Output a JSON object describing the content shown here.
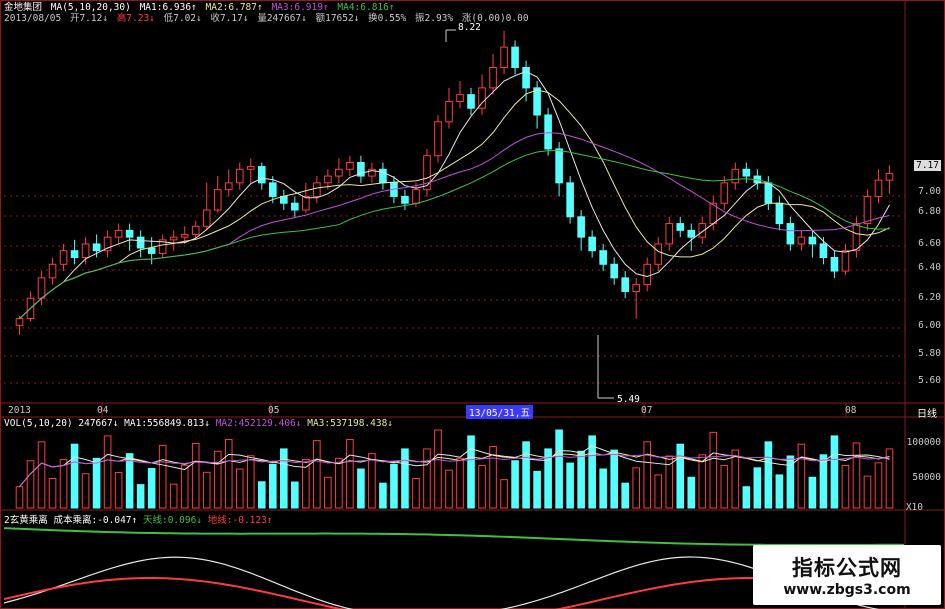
{
  "header": {
    "stock_name": "金地集团",
    "ma_label": "MA(5,10,20,30)",
    "ma1": "MA1:6.936↑",
    "ma2": "MA2:6.787↑",
    "ma3": "MA3:6.919↑",
    "ma4": "MA4:6.816↑",
    "date": "2013/08/05",
    "open": "开7.12↓",
    "high": "高7.23↓",
    "low": "低7.02↓",
    "close": "收7.17↓",
    "volume": "量247667↓",
    "amount": "额17652↓",
    "turnover": "换0.55%",
    "amplitude": "振2.93%",
    "change": "涨(0.00)0.00"
  },
  "price_axis": {
    "ticks": [
      "7.00",
      "6.80",
      "6.60",
      "6.40",
      "6.20",
      "6.00",
      "5.80",
      "5.60"
    ],
    "current_price": "7.17"
  },
  "annotations": {
    "high_mark": "8.22",
    "low_mark": "5.49"
  },
  "time_axis": {
    "labels": [
      "2013",
      "04",
      "05",
      "07",
      "08"
    ],
    "cursor_date": "13/05/31,五",
    "period": "日线"
  },
  "volume_panel": {
    "title": "VOL(5,10,20)",
    "value": "247667↓",
    "ma1": "MA1:556849.813↓",
    "ma2": "MA2:452129.406↓",
    "ma3": "MA3:537198.438↓",
    "ticks": [
      "100000",
      "50000"
    ],
    "unit": "X10"
  },
  "indicator_panel": {
    "title": "2玄黄乘离",
    "cost": "成本乘离:-0.047↑",
    "sky": "天线:0.096↓",
    "ground": "地线:-0.123↑"
  },
  "watermark": {
    "line1": "指标公式网",
    "line2": "www.zbgs3.com"
  },
  "colors": {
    "up": "#ff3c3c",
    "down": "#54ffff",
    "ma_white": "#e6e6e6",
    "ma_yellow": "#e8e89a",
    "ma_purple": "#c050e0",
    "ma_green": "#40c040",
    "grid": "#8b1a1a"
  },
  "chart_data": {
    "type": "candlestick",
    "price_ylim": [
      5.5,
      7.3
    ],
    "candles": [
      [
        6.05,
        6.1,
        5.98,
        6.12
      ],
      [
        6.1,
        6.25,
        6.08,
        6.3
      ],
      [
        6.25,
        6.4,
        6.2,
        6.45
      ],
      [
        6.4,
        6.5,
        6.35,
        6.55
      ],
      [
        6.5,
        6.6,
        6.45,
        6.65
      ],
      [
        6.6,
        6.55,
        6.5,
        6.68
      ],
      [
        6.55,
        6.65,
        6.5,
        6.7
      ],
      [
        6.65,
        6.6,
        6.55,
        6.72
      ],
      [
        6.6,
        6.7,
        6.55,
        6.75
      ],
      [
        6.7,
        6.75,
        6.65,
        6.8
      ],
      [
        6.75,
        6.7,
        6.6,
        6.8
      ],
      [
        6.7,
        6.62,
        6.55,
        6.75
      ],
      [
        6.62,
        6.58,
        6.5,
        6.7
      ],
      [
        6.58,
        6.68,
        6.55,
        6.72
      ],
      [
        6.68,
        6.7,
        6.6,
        6.75
      ],
      [
        6.7,
        6.72,
        6.65,
        6.78
      ],
      [
        6.72,
        6.78,
        6.68,
        6.82
      ],
      [
        6.78,
        6.9,
        6.75,
        7.1
      ],
      [
        6.9,
        7.05,
        6.88,
        7.15
      ],
      [
        7.05,
        7.1,
        7.0,
        7.2
      ],
      [
        7.1,
        7.2,
        7.05,
        7.25
      ],
      [
        7.2,
        7.22,
        7.1,
        7.28
      ],
      [
        7.22,
        7.1,
        7.05,
        7.25
      ],
      [
        7.1,
        7.0,
        6.95,
        7.15
      ],
      [
        7.0,
        6.95,
        6.9,
        7.05
      ],
      [
        6.95,
        6.9,
        6.85,
        7.0
      ],
      [
        6.9,
        7.0,
        6.88,
        7.1
      ],
      [
        7.0,
        7.1,
        6.95,
        7.15
      ],
      [
        7.1,
        7.15,
        7.05,
        7.2
      ],
      [
        7.15,
        7.2,
        7.1,
        7.28
      ],
      [
        7.2,
        7.25,
        7.15,
        7.3
      ],
      [
        7.25,
        7.15,
        7.1,
        7.3
      ],
      [
        7.15,
        7.2,
        7.1,
        7.25
      ],
      [
        7.2,
        7.1,
        7.05,
        7.25
      ],
      [
        7.1,
        7.0,
        6.95,
        7.15
      ],
      [
        7.0,
        6.95,
        6.9,
        7.05
      ],
      [
        6.95,
        7.05,
        6.92,
        7.1
      ],
      [
        7.05,
        7.3,
        7.0,
        7.35
      ],
      [
        7.3,
        7.55,
        7.25,
        7.6
      ],
      [
        7.55,
        7.7,
        7.5,
        7.8
      ],
      [
        7.7,
        7.75,
        7.65,
        7.85
      ],
      [
        7.75,
        7.65,
        7.6,
        7.8
      ],
      [
        7.65,
        7.8,
        7.6,
        7.9
      ],
      [
        7.8,
        7.95,
        7.75,
        8.05
      ],
      [
        7.95,
        8.1,
        7.9,
        8.22
      ],
      [
        8.1,
        7.95,
        7.9,
        8.15
      ],
      [
        7.95,
        7.8,
        7.7,
        8.0
      ],
      [
        7.8,
        7.6,
        7.5,
        7.85
      ],
      [
        7.6,
        7.35,
        7.3,
        7.65
      ],
      [
        7.35,
        7.1,
        7.0,
        7.4
      ],
      [
        7.1,
        6.85,
        6.8,
        7.15
      ],
      [
        6.85,
        6.7,
        6.6,
        6.9
      ],
      [
        6.7,
        6.6,
        6.55,
        6.75
      ],
      [
        6.6,
        6.5,
        6.45,
        6.65
      ],
      [
        6.5,
        6.4,
        6.35,
        6.55
      ],
      [
        6.4,
        6.3,
        6.25,
        6.45
      ],
      [
        6.3,
        6.35,
        6.1,
        6.4
      ],
      [
        6.35,
        6.5,
        6.3,
        6.55
      ],
      [
        6.5,
        6.65,
        6.45,
        6.7
      ],
      [
        6.65,
        6.8,
        6.6,
        6.85
      ],
      [
        6.8,
        6.75,
        6.7,
        6.85
      ],
      [
        6.75,
        6.7,
        6.6,
        6.8
      ],
      [
        6.7,
        6.8,
        6.65,
        6.85
      ],
      [
        6.8,
        6.95,
        6.75,
        7.0
      ],
      [
        6.95,
        7.1,
        6.9,
        7.15
      ],
      [
        7.1,
        7.2,
        7.05,
        7.25
      ],
      [
        7.2,
        7.15,
        7.1,
        7.25
      ],
      [
        7.15,
        7.1,
        7.05,
        7.2
      ],
      [
        7.1,
        6.95,
        6.9,
        7.15
      ],
      [
        6.95,
        6.8,
        6.75,
        7.0
      ],
      [
        6.8,
        6.65,
        6.6,
        6.85
      ],
      [
        6.65,
        6.7,
        6.6,
        6.75
      ],
      [
        6.7,
        6.65,
        6.55,
        6.75
      ],
      [
        6.65,
        6.55,
        6.5,
        6.7
      ],
      [
        6.55,
        6.45,
        6.4,
        6.6
      ],
      [
        6.45,
        6.6,
        6.42,
        6.65
      ],
      [
        6.6,
        6.8,
        6.55,
        6.85
      ],
      [
        6.8,
        7.0,
        6.75,
        7.05
      ],
      [
        7.0,
        7.12,
        6.95,
        7.2
      ],
      [
        7.12,
        7.17,
        7.02,
        7.23
      ]
    ]
  }
}
